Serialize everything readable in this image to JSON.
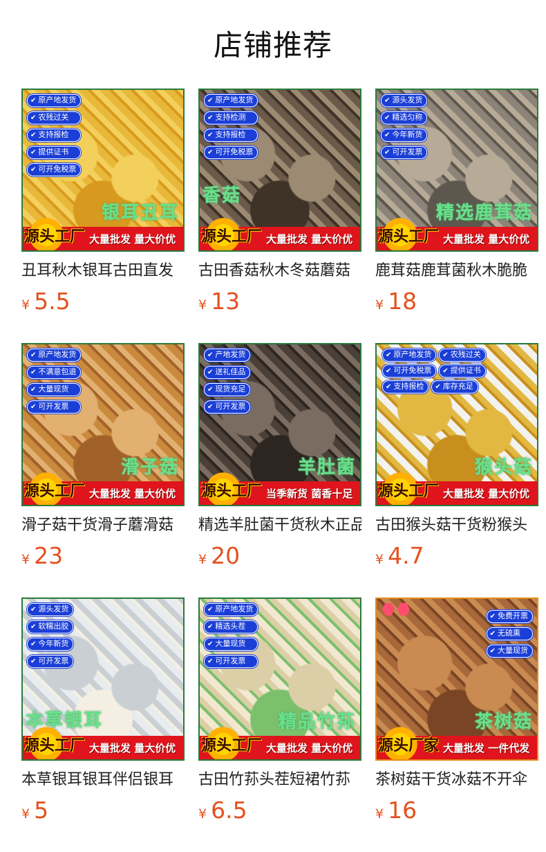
{
  "page_title": "店铺推荐",
  "products": [
    {
      "name": "丑耳秋木银耳古田直发",
      "currency": "¥",
      "price": "5.5",
      "badges": [
        "原产地发货",
        "农残过关",
        "支持报检",
        "提供证书",
        "可开免税票"
      ],
      "overlay_label": "银耳丑耳",
      "burst_text": "源头工厂",
      "banner_text": "大量批发 量大价优",
      "photo_colors": [
        "#e8b83a",
        "#f3cf5c",
        "#d89a1e"
      ]
    },
    {
      "name": "古田香菇秋木冬菇蘑菇",
      "currency": "¥",
      "price": "13",
      "badges": [
        "原产地发货",
        "支持检测",
        "支持报检",
        "可开免税票"
      ],
      "overlay_label": "香菇",
      "burst_text": "源头工厂",
      "banner_text": "大量批发 量大价优",
      "photo_colors": [
        "#6b5a4a",
        "#9c8a72",
        "#3f3328"
      ]
    },
    {
      "name": "鹿茸菇鹿茸菌秋木脆脆",
      "currency": "¥",
      "price": "18",
      "badges": [
        "源头发货",
        "精选匀称",
        "今年新货",
        "可开发票"
      ],
      "overlay_label": "精选鹿茸菇",
      "burst_text": "源头工厂",
      "banner_text": "大量批发 量大价优",
      "photo_colors": [
        "#8c8478",
        "#b7ab98",
        "#5e574d"
      ]
    },
    {
      "name": "滑子菇干货滑子蘑滑菇",
      "currency": "¥",
      "price": "23",
      "badges": [
        "原产地发货",
        "不满意包退",
        "大量现货",
        "可开发票"
      ],
      "overlay_label": "滑子菇",
      "burst_text": "源头工厂",
      "banner_text": "大量批发 量大价优",
      "photo_colors": [
        "#c98a3e",
        "#e2b070",
        "#a3612a"
      ]
    },
    {
      "name": "精选羊肚菌干货秋木正品",
      "currency": "¥",
      "price": "20",
      "badges": [
        "产地发货",
        "送礼佳品",
        "现货充足",
        "可开发票"
      ],
      "overlay_label": "羊肚菌",
      "burst_text": "源头工厂",
      "banner_text": "当季新货 菌香十足",
      "photo_colors": [
        "#4a4038",
        "#7a6c60",
        "#2c2520"
      ]
    },
    {
      "name": "古田猴头菇干货粉猴头",
      "currency": "¥",
      "price": "4.7",
      "badges": [
        "原产地发货",
        "农残过关",
        "可开免税票",
        "提供证书",
        "支持报检",
        "库存充足"
      ],
      "overlay_label": "猴头菇",
      "burst_text": "源头工厂",
      "banner_text": "大量批发 量大价优",
      "photo_colors": [
        "#f2f2ee",
        "#e2b842",
        "#c98f1e"
      ]
    },
    {
      "name": "本草银耳银耳伴侣银耳",
      "currency": "¥",
      "price": "5",
      "badges": [
        "源头发货",
        "软糯出胶",
        "今年新货",
        "可开发票"
      ],
      "overlay_label": "本草银耳",
      "burst_text": "源头工厂",
      "banner_text": "大量批发 量大价优",
      "photo_colors": [
        "#e8ecef",
        "#c9cfd3",
        "#f4efe2"
      ]
    },
    {
      "name": "古田竹荪头茬短裙竹荪",
      "currency": "¥",
      "price": "6.5",
      "badges": [
        "原产地发货",
        "精选头茬",
        "大量现货",
        "可开发票"
      ],
      "overlay_label": "精品竹荪",
      "burst_text": "源头工厂",
      "banner_text": "大量批发 量大价优",
      "photo_colors": [
        "#f1e8cf",
        "#dccfa8",
        "#7cc06c"
      ]
    },
    {
      "name": "茶树菇干货冰菇不开伞",
      "currency": "¥",
      "price": "16",
      "badges": [
        "免费开票",
        "无硫熏",
        "大量现货"
      ],
      "overlay_label": "茶树菇",
      "burst_text": "源头厂家",
      "banner_text": "大量批发 一件代发",
      "photo_colors": [
        "#a8683a",
        "#c98b52",
        "#7a4524"
      ]
    }
  ]
}
